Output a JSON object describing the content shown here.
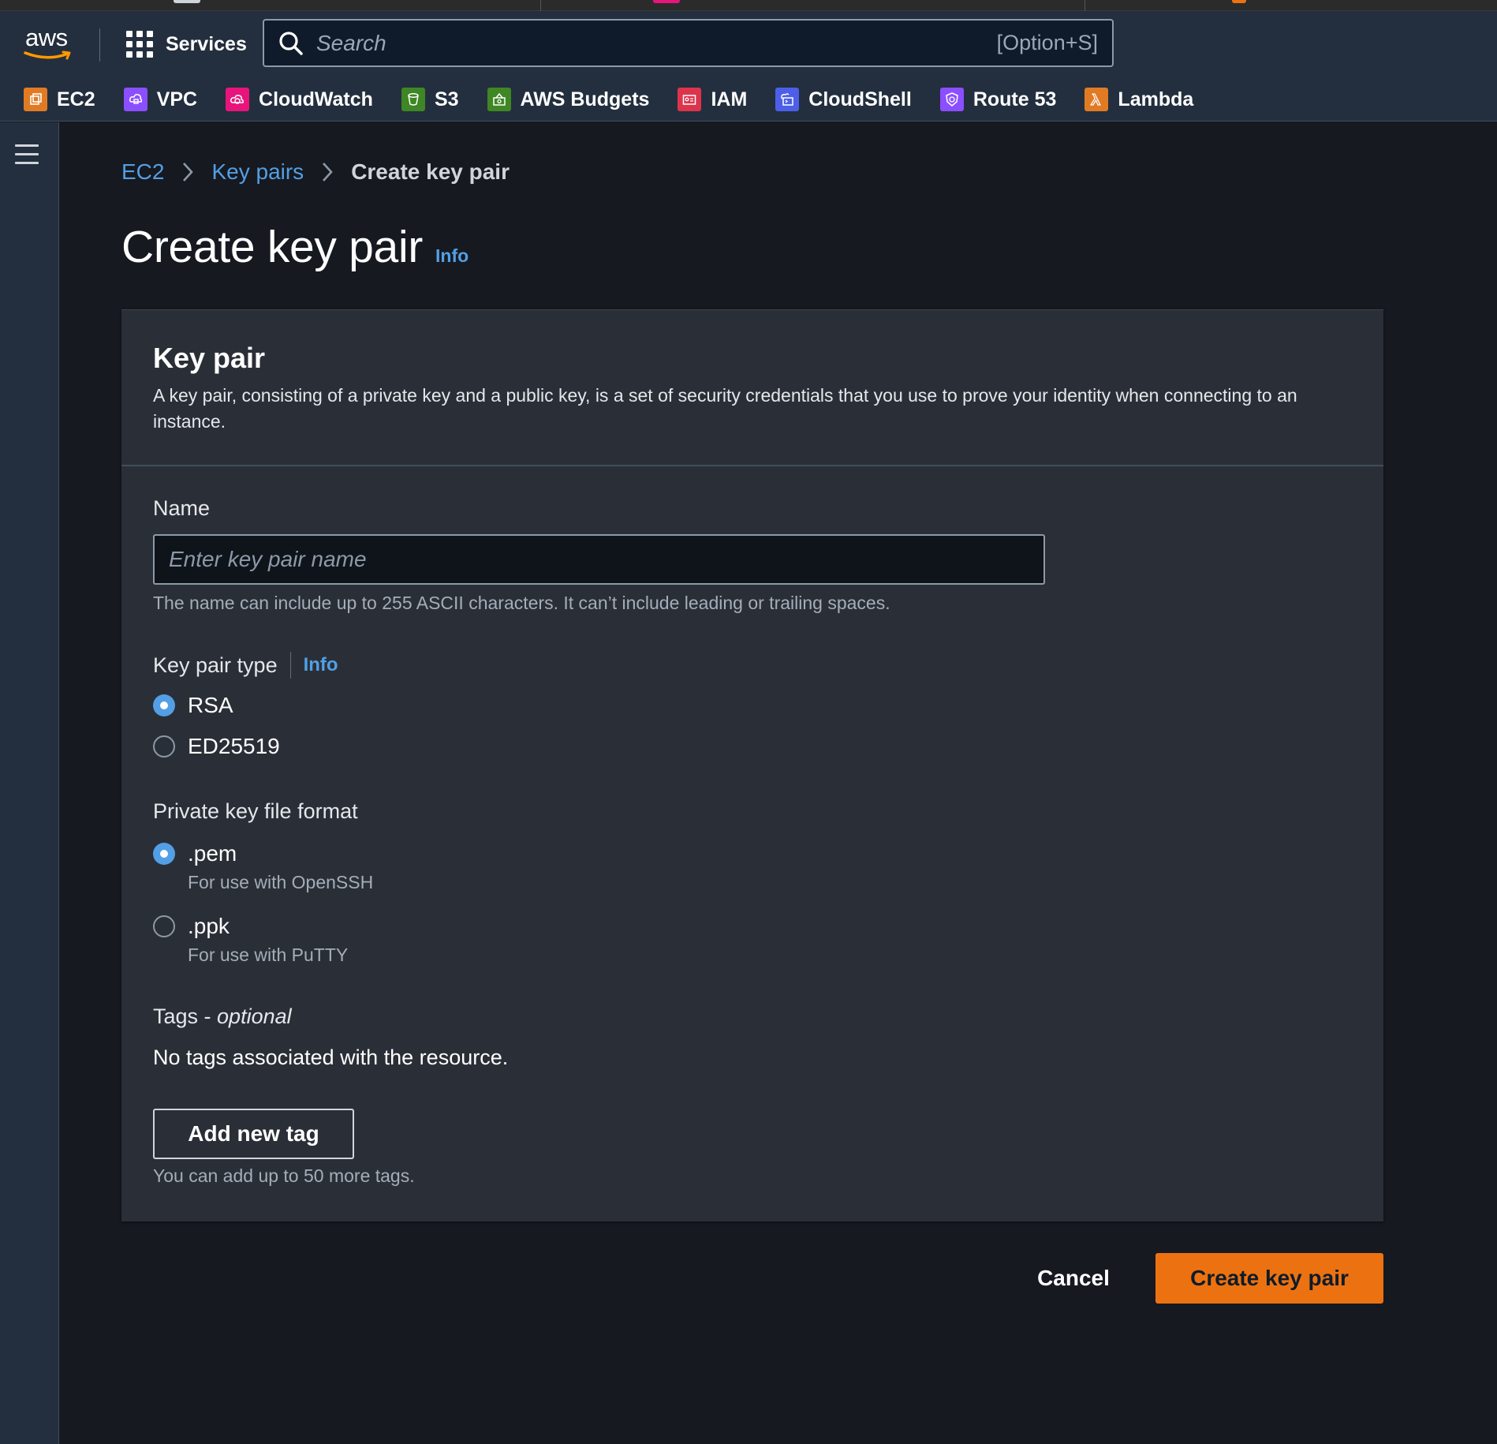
{
  "nav": {
    "logo_text": "aws",
    "services_label": "Services",
    "search_placeholder": "Search",
    "search_shortcut": "[Option+S]",
    "favorites": [
      {
        "label": "EC2",
        "icon": "ec2-icon",
        "color": "#e07b24"
      },
      {
        "label": "VPC",
        "icon": "vpc-icon",
        "color": "#8c4fff"
      },
      {
        "label": "CloudWatch",
        "icon": "cloudwatch-icon",
        "color": "#e7157b"
      },
      {
        "label": "S3",
        "icon": "s3-icon",
        "color": "#3f8624"
      },
      {
        "label": "AWS Budgets",
        "icon": "budgets-icon",
        "color": "#3f8624"
      },
      {
        "label": "IAM",
        "icon": "iam-icon",
        "color": "#dd344c"
      },
      {
        "label": "CloudShell",
        "icon": "cloudshell-icon",
        "color": "#4d5fe8"
      },
      {
        "label": "Route 53",
        "icon": "route53-icon",
        "color": "#8c4fff"
      },
      {
        "label": "Lambda",
        "icon": "lambda-icon",
        "color": "#e07b24"
      }
    ]
  },
  "breadcrumb": {
    "items": [
      "EC2",
      "Key pairs"
    ],
    "current": "Create key pair"
  },
  "page": {
    "title": "Create key pair",
    "info": "Info"
  },
  "panel": {
    "title": "Key pair",
    "description": "A key pair, consisting of a private key and a public key, is a set of security credentials that you use to prove your identity when connecting to an instance."
  },
  "form": {
    "name_label": "Name",
    "name_placeholder": "Enter key pair name",
    "name_value": "",
    "name_hint": "The name can include up to 255 ASCII characters. It can’t include leading or trailing spaces.",
    "type_label": "Key pair type",
    "type_info": "Info",
    "type_options": [
      {
        "label": "RSA",
        "selected": true
      },
      {
        "label": "ED25519",
        "selected": false
      }
    ],
    "format_label": "Private key file format",
    "format_options": [
      {
        "label": ".pem",
        "description": "For use with OpenSSH",
        "selected": true
      },
      {
        "label": ".ppk",
        "description": "For use with PuTTY",
        "selected": false
      }
    ],
    "tags_label": "Tags - ",
    "tags_optional": "optional",
    "no_tags": "No tags associated with the resource.",
    "add_tag_label": "Add new tag",
    "tag_limit_hint": "You can add up to 50 more tags."
  },
  "actions": {
    "cancel": "Cancel",
    "submit": "Create key pair"
  },
  "colors": {
    "accent_link": "#539fe5",
    "primary_button": "#ec7211",
    "nav_bg": "#232f3e",
    "page_bg": "#16191f",
    "panel_bg": "#2a2f37"
  }
}
